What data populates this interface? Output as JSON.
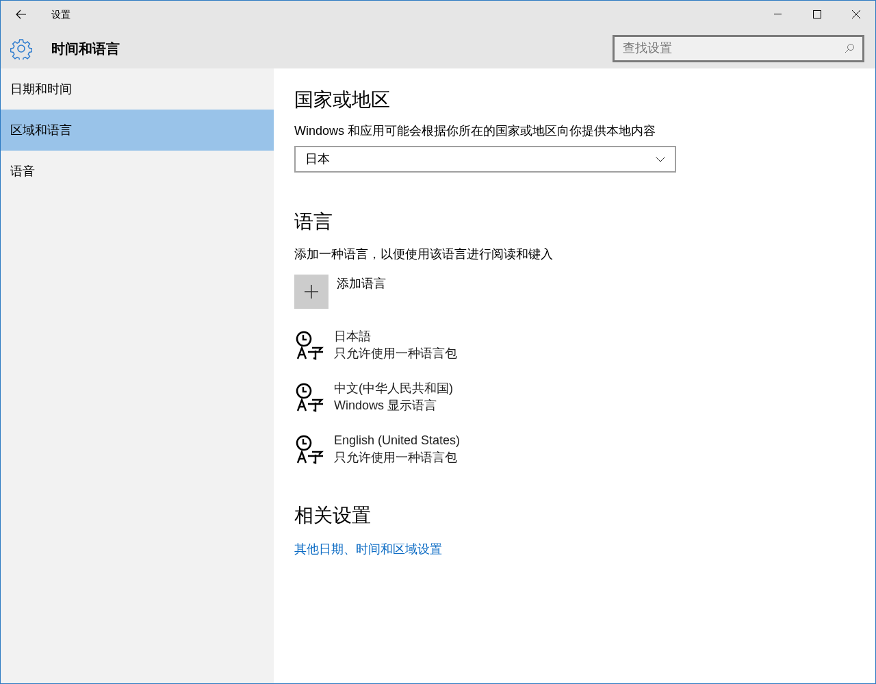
{
  "window": {
    "title": "设置"
  },
  "header": {
    "title": "时间和语言"
  },
  "search": {
    "placeholder": "查找设置"
  },
  "sidebar": {
    "items": [
      {
        "label": "日期和时间",
        "selected": false
      },
      {
        "label": "区域和语言",
        "selected": true
      },
      {
        "label": "语音",
        "selected": false
      }
    ]
  },
  "region": {
    "heading": "国家或地区",
    "description": "Windows 和应用可能会根据你所在的国家或地区向你提供本地内容",
    "dropdown": {
      "value": "日本"
    }
  },
  "languages": {
    "heading": "语言",
    "description": "添加一种语言，以便使用该语言进行阅读和键入",
    "add_label": "添加语言",
    "items": [
      {
        "name": "日本語",
        "detail": "只允许使用一种语言包"
      },
      {
        "name": "中文(中华人民共和国)",
        "detail": "Windows 显示语言"
      },
      {
        "name": "English (United States)",
        "detail": "只允许使用一种语言包"
      }
    ]
  },
  "related": {
    "heading": "相关设置",
    "link": "其他日期、时间和区域设置"
  }
}
